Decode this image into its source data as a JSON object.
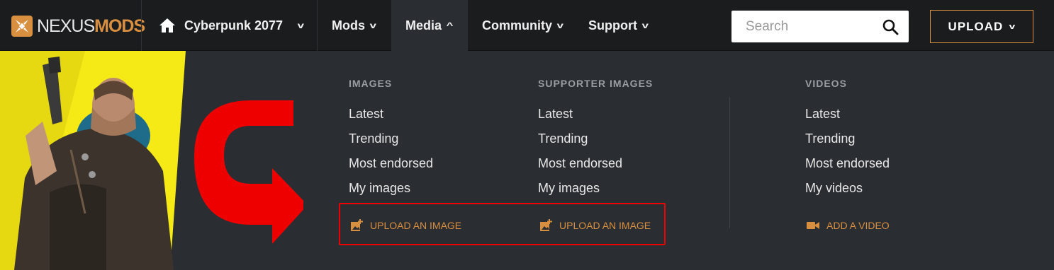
{
  "header": {
    "logo": {
      "part1": "NEXUS",
      "part2": "MODS"
    },
    "game": {
      "label": "Cyberpunk 2077",
      "icon": "home-icon"
    },
    "nav": [
      {
        "label": "Mods"
      },
      {
        "label": "Media"
      },
      {
        "label": "Community"
      },
      {
        "label": "Support"
      }
    ],
    "search": {
      "placeholder": "Search",
      "icon": "search-icon"
    },
    "upload": {
      "label": "UPLOAD"
    }
  },
  "menu": {
    "images": {
      "title": "IMAGES",
      "links": [
        "Latest",
        "Trending",
        "Most endorsed",
        "My images"
      ],
      "action": {
        "label": "UPLOAD AN IMAGE",
        "icon": "add-image-icon"
      }
    },
    "supporter_images": {
      "title": "SUPPORTER IMAGES",
      "links": [
        "Latest",
        "Trending",
        "Most endorsed",
        "My images"
      ],
      "action": {
        "label": "UPLOAD AN IMAGE",
        "icon": "add-image-icon"
      }
    },
    "videos": {
      "title": "VIDEOS",
      "links": [
        "Latest",
        "Trending",
        "Most endorsed",
        "My videos"
      ],
      "action": {
        "label": "ADD A VIDEO",
        "icon": "video-camera-icon"
      }
    }
  },
  "colors": {
    "accent": "#d98f40",
    "annotation": "#ee0000",
    "background": "#2a2d31",
    "topbar": "#1b1c1e"
  }
}
